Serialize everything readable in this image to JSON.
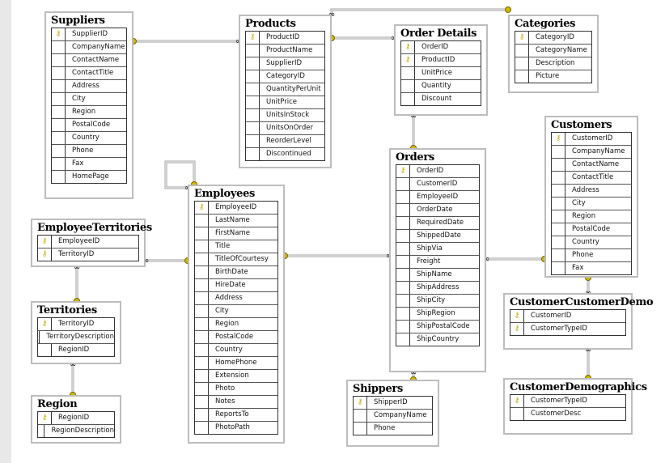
{
  "tables": [
    {
      "id": "suppliers",
      "name": "Suppliers",
      "columns": [
        "SupplierID",
        "CompanyName",
        "ContactName",
        "ContactTitle",
        "Address",
        "City",
        "Region",
        "PostalCode",
        "Country",
        "Phone",
        "Fax",
        "HomePage"
      ],
      "pk": [
        "SupplierID"
      ]
    },
    {
      "id": "products",
      "name": "Products",
      "columns": [
        "ProductID",
        "ProductName",
        "SupplierID",
        "CategoryID",
        "QuantityPerUnit",
        "UnitPrice",
        "UnitsInStock",
        "UnitsOnOrder",
        "ReorderLevel",
        "Discontinued"
      ],
      "pk": [
        "ProductID"
      ]
    },
    {
      "id": "order-details",
      "name": "Order Details",
      "columns": [
        "OrderID",
        "ProductID",
        "UnitPrice",
        "Quantity",
        "Discount"
      ],
      "pk": [
        "OrderID",
        "ProductID"
      ]
    },
    {
      "id": "categories",
      "name": "Categories",
      "columns": [
        "CategoryID",
        "CategoryName",
        "Description",
        "Picture"
      ],
      "pk": [
        "CategoryID"
      ]
    },
    {
      "id": "customers",
      "name": "Customers",
      "columns": [
        "CustomerID",
        "CompanyName",
        "ContactName",
        "ContactTitle",
        "Address",
        "City",
        "Region",
        "PostalCode",
        "Country",
        "Phone",
        "Fax"
      ],
      "pk": [
        "CustomerID"
      ]
    },
    {
      "id": "employees",
      "name": "Employees",
      "columns": [
        "EmployeeID",
        "LastName",
        "FirstName",
        "Title",
        "TitleOfCourtesy",
        "BirthDate",
        "HireDate",
        "Address",
        "City",
        "Region",
        "PostalCode",
        "Country",
        "HomePhone",
        "Extension",
        "Photo",
        "Notes",
        "ReportsTo",
        "PhotoPath"
      ],
      "pk": [
        "EmployeeID"
      ]
    },
    {
      "id": "employee-territories",
      "name": "EmployeeTerritories",
      "columns": [
        "EmployeeID",
        "TerritoryID"
      ],
      "pk": [
        "EmployeeID",
        "TerritoryID"
      ]
    },
    {
      "id": "territories",
      "name": "Territories",
      "columns": [
        "TerritoryID",
        "TerritoryDescription",
        "RegionID"
      ],
      "pk": [
        "TerritoryID"
      ]
    },
    {
      "id": "region",
      "name": "Region",
      "columns": [
        "RegionID",
        "RegionDescription"
      ],
      "pk": [
        "RegionID"
      ]
    },
    {
      "id": "orders",
      "name": "Orders",
      "columns": [
        "OrderID",
        "CustomerID",
        "EmployeeID",
        "OrderDate",
        "RequiredDate",
        "ShippedDate",
        "ShipVia",
        "Freight",
        "ShipName",
        "ShipAddress",
        "ShipCity",
        "ShipRegion",
        "ShipPostalCode",
        "ShipCountry"
      ],
      "pk": [
        "OrderID"
      ]
    },
    {
      "id": "shippers",
      "name": "Shippers",
      "columns": [
        "ShipperID",
        "CompanyName",
        "Phone"
      ],
      "pk": [
        "ShipperID"
      ]
    },
    {
      "id": "customer-customer-demo",
      "name": "CustomerCustomerDemo",
      "columns": [
        "CustomerID",
        "CustomerTypeID"
      ],
      "pk": [
        "CustomerID",
        "CustomerTypeID"
      ]
    },
    {
      "id": "customer-demographics",
      "name": "CustomerDemographics",
      "columns": [
        "CustomerTypeID",
        "CustomerDesc"
      ],
      "pk": [
        "CustomerTypeID"
      ]
    }
  ],
  "relationships": [
    {
      "from": "suppliers",
      "to": "products"
    },
    {
      "from": "products",
      "to": "order-details"
    },
    {
      "from": "categories",
      "to": "products"
    },
    {
      "from": "orders",
      "to": "order-details"
    },
    {
      "from": "employees",
      "to": "employees"
    },
    {
      "from": "employees",
      "to": "employee-territories"
    },
    {
      "from": "territories",
      "to": "employee-territories"
    },
    {
      "from": "region",
      "to": "territories"
    },
    {
      "from": "employees",
      "to": "orders"
    },
    {
      "from": "customers",
      "to": "orders"
    },
    {
      "from": "shippers",
      "to": "orders"
    },
    {
      "from": "customers",
      "to": "customer-customer-demo"
    },
    {
      "from": "customer-demographics",
      "to": "customer-customer-demo"
    }
  ],
  "colors": {
    "key": "#d4b800",
    "line": "#a0a0a0",
    "border": "#bdbdbd"
  },
  "icons": {
    "primary_key": "key-icon",
    "one_end": "key-icon",
    "many_end": "infinity-icon"
  }
}
